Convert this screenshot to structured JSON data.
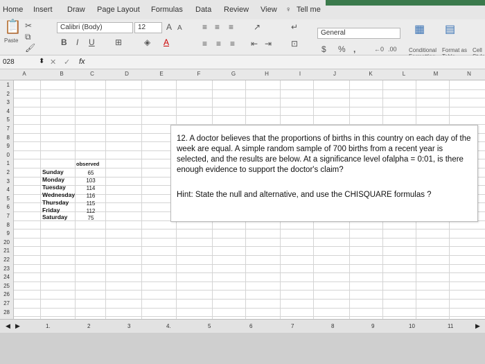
{
  "tabs": [
    "Home",
    "Insert",
    "Draw",
    "Page Layout",
    "Formulas",
    "Data",
    "Review",
    "View",
    "Tell me"
  ],
  "ribbon": {
    "paste_label": "Paste",
    "font_name": "Calibri (Body)",
    "font_size": "12",
    "grow_font": "A",
    "shrink_font": "A",
    "bold": "B",
    "italic": "I",
    "underline": "U",
    "number_format": "General",
    "currency": "$",
    "percent": "%",
    "comma": ",",
    "conditional_formatting": "Conditional Formatting",
    "format_as_table": "Format as Table",
    "cell_styles": "Cell Styles"
  },
  "formula_bar": {
    "name_box": "028",
    "fx": "fx"
  },
  "columns": [
    "A",
    "B",
    "C",
    "D",
    "E",
    "F",
    "G",
    "H",
    "I",
    "J",
    "K",
    "L",
    "M",
    "N"
  ],
  "rows": [
    "1",
    "2",
    "3",
    "4",
    "5",
    "7",
    "8",
    "9",
    "0",
    "1",
    "2",
    "3",
    "4",
    "5",
    "6",
    "7",
    "8",
    "9",
    "20",
    "21",
    "22",
    "23",
    "24",
    "25",
    "26",
    "27",
    "28"
  ],
  "table": {
    "header": "observed",
    "days": [
      "Sunday",
      "Monday",
      "Tuesday",
      "Wednesday",
      "Thursday",
      "Friday",
      "Saturday"
    ],
    "observed": [
      "65",
      "103",
      "114",
      "116",
      "115",
      "112",
      "75"
    ]
  },
  "textbox": {
    "question": "12. A doctor believes that the proportions of births in this country on each day of the week are equal. A simple random sample of 700 births from a recent year is selected, and the results are below. At a significance level ofalpha = 0:01, is there enough evidence to support the doctor's claim?",
    "hint": "Hint: State the null and alternative, and use the CHISQUARE formulas ?"
  },
  "sheet_pages": [
    "1.",
    "2",
    "3",
    "4.",
    "5",
    "6",
    "7",
    "8",
    "9",
    "10",
    "11"
  ],
  "colors": {
    "ribbon_bg": "#ececec",
    "title_green": "#3b7a4c",
    "grid_line": "#d4d4d4"
  }
}
